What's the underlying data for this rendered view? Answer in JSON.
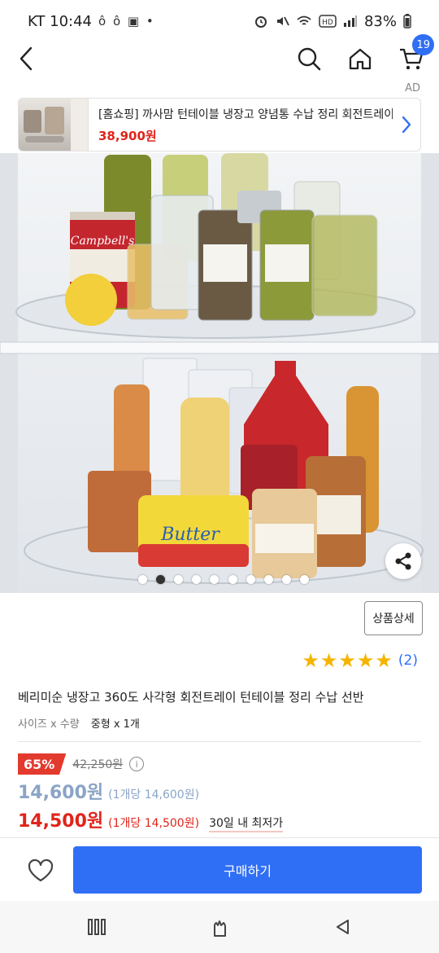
{
  "status_bar": {
    "carrier_time": "KT 10:44",
    "left_icons": "ô ô ▣ •",
    "battery": "83%"
  },
  "nav": {
    "cart_count": "19"
  },
  "ad": {
    "label": "AD",
    "title": "[홈쇼핑] 까사맘 턴테이블 냉장고 양념통 수납 정리 회전트레이",
    "price": "38,900원"
  },
  "product": {
    "detail_button": "상품상세",
    "rating": 5,
    "review_count": "(2)",
    "title": "베리미순 냉장고 360도 사각형 회전트레이 턴테이블 정리 수납 선반",
    "option_label": "사이즈 x 수량",
    "option_value": "중형 x 1개",
    "image_count": 10,
    "active_image": 1
  },
  "price": {
    "discount": "65%",
    "original": "42,250원",
    "sale": "14,600원",
    "sale_unit": "(1개당 14,600원)",
    "best": "14,500원",
    "best_unit": "(1개당 14,500원)",
    "lowest_tag": "30일 내 최저가"
  },
  "purchase": {
    "buy_label": "구매하기"
  },
  "colors": {
    "accent": "#2f6ff5",
    "sale_red": "#e0241b",
    "star": "#f5b400"
  }
}
